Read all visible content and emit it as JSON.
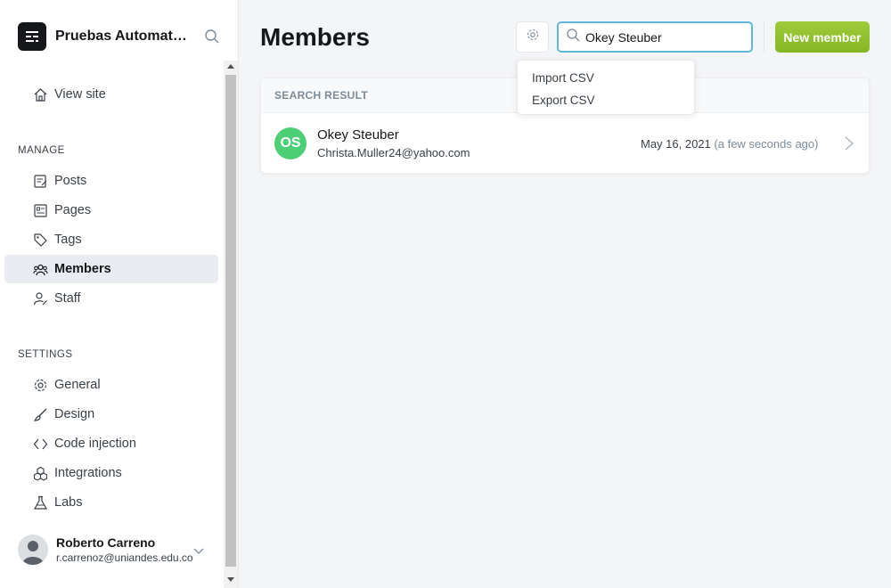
{
  "brand": {
    "title": "Pruebas Automatización",
    "icon": "ghost-logo-icon"
  },
  "sidebar": {
    "view_site": "View site",
    "manage_label": "MANAGE",
    "manage_items": [
      {
        "label": "Posts",
        "icon": "posts-icon"
      },
      {
        "label": "Pages",
        "icon": "pages-icon"
      },
      {
        "label": "Tags",
        "icon": "tag-icon"
      },
      {
        "label": "Members",
        "icon": "members-icon",
        "active": true
      },
      {
        "label": "Staff",
        "icon": "staff-icon"
      }
    ],
    "settings_label": "SETTINGS",
    "settings_items": [
      {
        "label": "General",
        "icon": "gear-icon"
      },
      {
        "label": "Design",
        "icon": "brush-icon"
      },
      {
        "label": "Code injection",
        "icon": "code-icon"
      },
      {
        "label": "Integrations",
        "icon": "integrations-icon"
      },
      {
        "label": "Labs",
        "icon": "flask-icon"
      }
    ]
  },
  "user": {
    "name": "Roberto Carreno",
    "email": "r.carrenoz@uniandes.edu.co"
  },
  "main": {
    "title": "Members",
    "search_value": "Okey Steuber",
    "new_member_label": "New member",
    "dropdown": {
      "items": [
        "Import CSV",
        "Export CSV"
      ]
    },
    "results": {
      "header": "SEARCH RESULT",
      "rows": [
        {
          "initials": "OS",
          "name": "Okey Steuber",
          "email": "Christa.Muller24@yahoo.com",
          "date": "May 16, 2021",
          "relative": "(a few seconds ago)"
        }
      ]
    }
  },
  "colors": {
    "accent_green": "#94c130",
    "avatar_green": "#4ccf77",
    "search_focus": "#5fb8dc"
  }
}
